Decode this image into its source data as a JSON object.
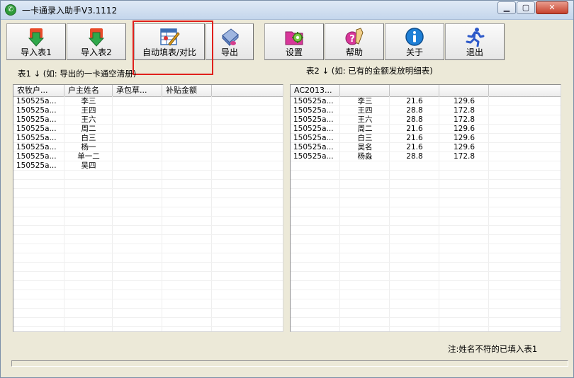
{
  "window": {
    "title": "一卡通录入助手V3.1112"
  },
  "toolbar": [
    {
      "id": "import1",
      "label": "导入表1",
      "icon": "green-arrow-down-icon"
    },
    {
      "id": "import2",
      "label": "导入表2",
      "icon": "green-arrow-down-icon"
    },
    {
      "id": "autofill",
      "label": "自动填表/对比",
      "icon": "spreadsheet-pencil-icon"
    },
    {
      "id": "export",
      "label": "导出",
      "icon": "eraser-export-icon"
    },
    {
      "id": "settings",
      "label": "设置",
      "icon": "gear-folder-icon"
    },
    {
      "id": "help",
      "label": "帮助",
      "icon": "help-pen-icon"
    },
    {
      "id": "about",
      "label": "关于",
      "icon": "info-icon"
    },
    {
      "id": "exit",
      "label": "退出",
      "icon": "running-man-icon"
    }
  ],
  "table1": {
    "caption": "表1 ↓  (如: 导出的一卡通空清册)",
    "columns": [
      "农牧户...",
      "户主姓名",
      "承包草...",
      "补贴金额"
    ],
    "rows": [
      [
        "150525a...",
        "李三",
        "",
        ""
      ],
      [
        "150525a...",
        "王四",
        "",
        ""
      ],
      [
        "150525a...",
        "王六",
        "",
        ""
      ],
      [
        "150525a...",
        "周二",
        "",
        ""
      ],
      [
        "150525a...",
        "白三",
        "",
        ""
      ],
      [
        "150525a...",
        "杨一",
        "",
        ""
      ],
      [
        "150525a...",
        "单一二",
        "",
        ""
      ],
      [
        "150525a...",
        "吴四",
        "",
        ""
      ]
    ]
  },
  "table2": {
    "caption": "表2 ↓   (如: 已有的金额发放明细表)",
    "columns": [
      "AC2013...",
      "",
      "",
      ""
    ],
    "rows": [
      [
        "150525a...",
        "李三",
        "21.6",
        "129.6"
      ],
      [
        "150525a...",
        "王四",
        "28.8",
        "172.8"
      ],
      [
        "150525a...",
        "王六",
        "28.8",
        "172.8"
      ],
      [
        "150525a...",
        "周二",
        "21.6",
        "129.6"
      ],
      [
        "150525a...",
        "白三",
        "21.6",
        "129.6"
      ],
      [
        "150525a...",
        "吴名",
        "21.6",
        "129.6"
      ],
      [
        "150525a...",
        "杨淼",
        "28.8",
        "172.8"
      ]
    ]
  },
  "footnote": "注:姓名不符的已填入表1"
}
